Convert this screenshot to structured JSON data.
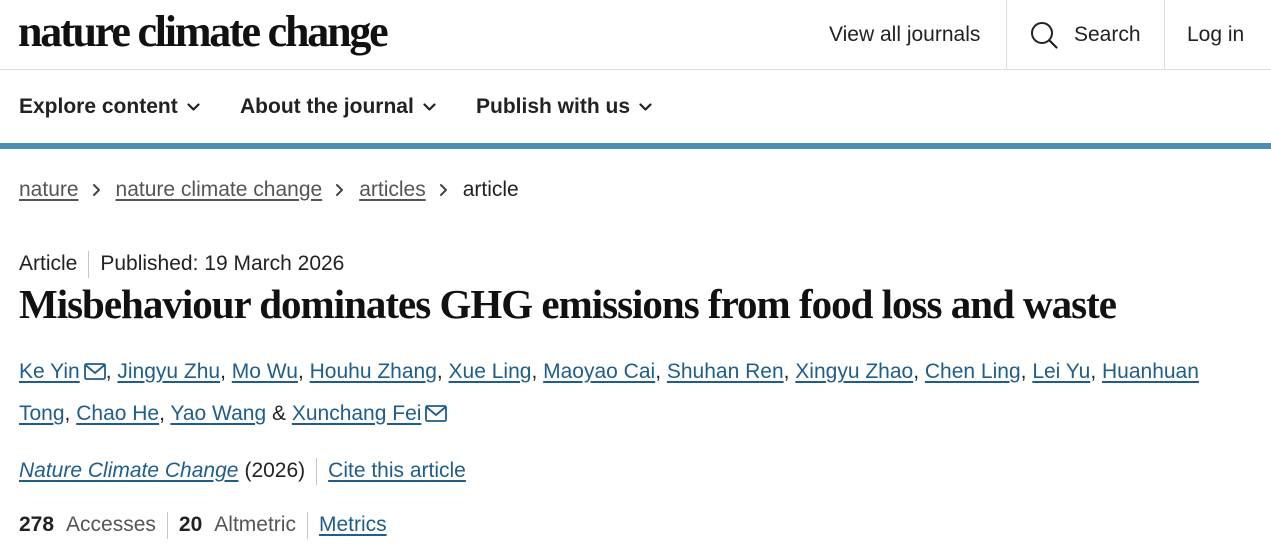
{
  "header": {
    "logo": "nature climate change",
    "view_all_journals": "View all journals",
    "search_label": "Search",
    "login_label": "Log in"
  },
  "nav": {
    "items": [
      {
        "label": "Explore content"
      },
      {
        "label": "About the journal"
      },
      {
        "label": "Publish with us"
      }
    ]
  },
  "breadcrumb": {
    "items": [
      "nature",
      "nature climate change",
      "articles"
    ],
    "current": "article"
  },
  "article": {
    "type": "Article",
    "published": "Published: 19 March 2026",
    "title": "Misbehaviour dominates GHG emissions from food loss and waste",
    "authors": [
      {
        "name": "Ke Yin",
        "email": true
      },
      {
        "name": "Jingyu Zhu"
      },
      {
        "name": "Mo Wu"
      },
      {
        "name": "Houhu Zhang"
      },
      {
        "name": "Xue Ling"
      },
      {
        "name": "Maoyao Cai"
      },
      {
        "name": "Shuhan Ren"
      },
      {
        "name": "Xingyu Zhao"
      },
      {
        "name": "Chen Ling"
      },
      {
        "name": "Lei Yu"
      },
      {
        "name": "Huanhuan Tong"
      },
      {
        "name": "Chao He"
      },
      {
        "name": "Yao Wang"
      },
      {
        "name": "Xunchang Fei",
        "email": true
      }
    ],
    "journal": "Nature Climate Change",
    "year": "(2026)",
    "cite_label": "Cite this article"
  },
  "metrics": {
    "accesses_count": "278",
    "accesses_label": "Accesses",
    "altmetric_count": "20",
    "altmetric_label": "Altmetric",
    "metrics_link": "Metrics"
  },
  "colors": {
    "accent_rule": "#4a8db5",
    "link": "#1f5d8c"
  },
  "icons": {
    "search": "search-icon",
    "chevron": "chevron-down-icon",
    "breadcrumb_separator": "chevron-right-icon",
    "email": "envelope-icon"
  }
}
